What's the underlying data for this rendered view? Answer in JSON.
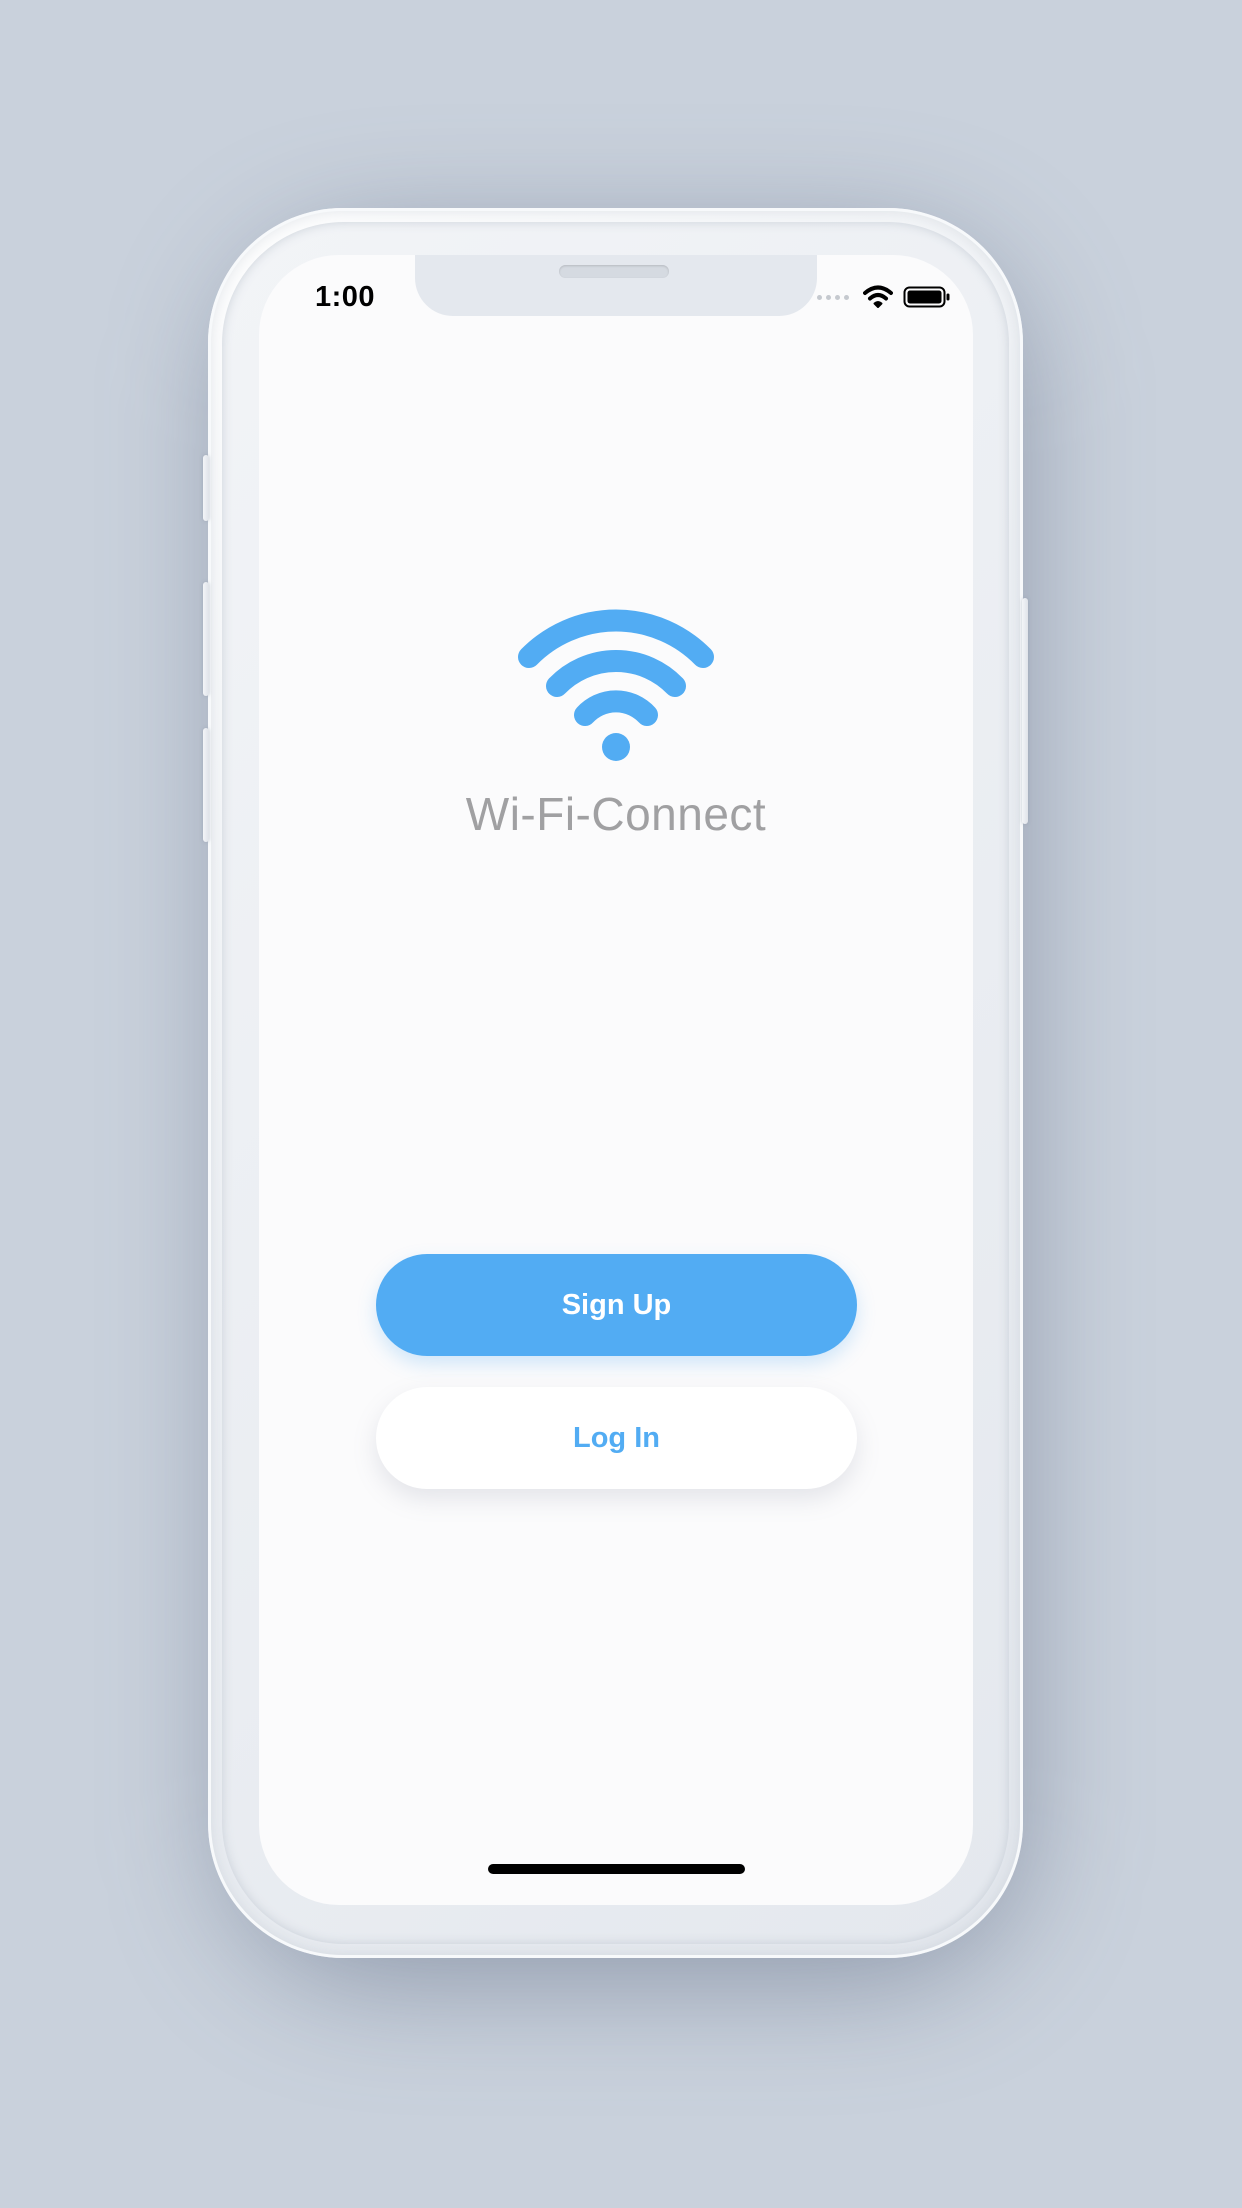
{
  "status_bar": {
    "time": "1:00",
    "wifi_icon": "wifi-icon",
    "battery_icon": "battery-icon",
    "signal_icon": "signal-dots-icon"
  },
  "app": {
    "logo_icon": "wifi-logo-icon",
    "title": "Wi-Fi-Connect"
  },
  "actions": {
    "signup_label": "Sign Up",
    "login_label": "Log In"
  },
  "colors": {
    "accent": "#52acf3",
    "title_gray": "#a0a0a2",
    "background": "#c9d1dc",
    "screen": "#fbfbfc"
  }
}
